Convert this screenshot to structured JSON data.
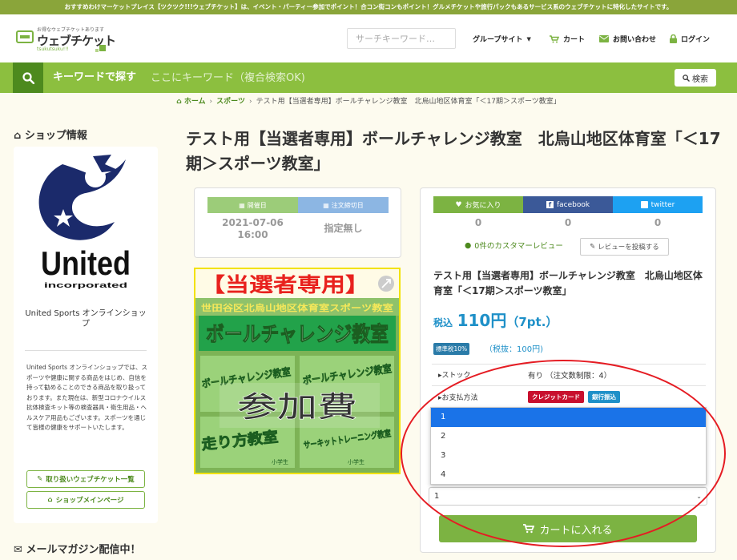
{
  "notice": "おすすめわけマーケットプレイス【ツクツク!!!ウェブチケット】は、イベント・パーティー参加でポイント！合コン街コンもポイント！グルメチケットや旅行パックもあるサービス系のウェブチケットに特化したサイトです。",
  "header": {
    "logo_tagline": "お得なウェブチケットあります",
    "logo_main": "ウェブチケット",
    "logo_sub": "tsukutsuku!!!",
    "search_placeholder": "サーチキーワード…",
    "nav": {
      "group": "グループサイト",
      "cart": "カート",
      "contact": "お問い合わせ",
      "login": "ログイン"
    }
  },
  "kwbar": {
    "label": "キーワードで探す",
    "placeholder": "ここにキーワード（複合検索OK)",
    "search_button": "検索"
  },
  "breadcrumb": {
    "home": "ホーム",
    "category": "スポーツ",
    "current": "テスト用【当選者専用】ボールチャレンジ教室　北烏山地区体育室「＜17期＞スポーツ教室」"
  },
  "sidebar": {
    "title": "ショップ情報",
    "shop_logo_text": "United",
    "shop_logo_sub": "incorporated",
    "shop_name": "United Sports オンラインショップ",
    "description": "United Sports オンラインショップでは、スポーツや健康に関する商品をはじめ、自信を持って勧めることのできる商品を取り扱っております。また現在は、新型コロナウイルス抗体検査キット等の検査器具・衛生用品・ヘルスケア用品もございます。スポーツを通じて皆様の健康をサポートいたします。",
    "button_tickets": "取り扱いウェブチケット一覧",
    "button_shop": "ショップメインページ",
    "mail_title": "メールマガジン配信中！"
  },
  "product": {
    "title": "テスト用【当選者専用】ボールチャレンジ教室　北烏山地区体育室「＜17期＞スポーツ教室」",
    "event_date_label": "開催日",
    "event_date": "2021-07-06",
    "event_time": "16:00",
    "deadline_label": "注文締切日",
    "deadline": "指定無し",
    "image_banner": "【当選者専用】",
    "image_heading": "ボールチャレンジ教室",
    "image_overlay": "参加費",
    "image_poster_title": "世田谷区北烏山地区体育室スポーツ教室",
    "image_tile_1": "ボールチャレンジ教室",
    "image_tile_2": "ボールチャレンジ教室",
    "image_tile_3": "走り方教室",
    "image_tile_4": "サーキットトレーニング教室",
    "image_grade_1": "小学生",
    "image_grade_2": "小学生"
  },
  "info": {
    "favorite": "お気に入り",
    "favorite_count": "0",
    "facebook": "facebook",
    "facebook_count": "0",
    "twitter": "twitter",
    "twitter_count": "0",
    "review_count_text": "0件のカスタマーレビュー",
    "review_button": "レビューを投稿する",
    "title": "テスト用【当選者専用】ボールチャレンジ教室　北烏山地区体育室「＜17期＞スポーツ教室」",
    "price_prefix": "税込",
    "price": "110円",
    "points": "（7pt.）",
    "tax_badge": "標準税10%",
    "tax_note": "（税抜：100円)",
    "stock_label": "ストック",
    "stock_value": "有り （注文数制限：4）",
    "payment_label": "お支払方法",
    "payment_credit": "クレジットカード",
    "payment_bank": "銀行振込",
    "quantity_value": "1",
    "quantity_options": [
      "1",
      "2",
      "3",
      "4"
    ],
    "cart_button": "カートに入れる"
  },
  "colors": {
    "brand_green": "#7cb342",
    "dark_green": "#4d8a1e",
    "price_blue": "#1e90c8",
    "highlight_ring": "#e51c23"
  }
}
